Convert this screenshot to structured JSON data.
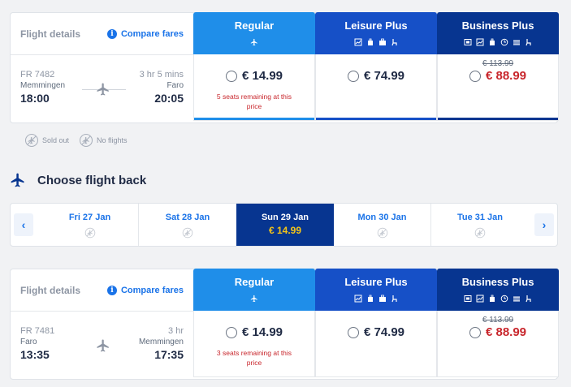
{
  "colors": {
    "regular": "#1f8ee9",
    "leisure": "#1650c7",
    "business": "#073590",
    "selected_date": "#073590",
    "promo_price": "#c8262c",
    "accent": "#1a73e8"
  },
  "outbound": {
    "details_title": "Flight details",
    "compare_label": "Compare fares",
    "flight_number": "FR 7482",
    "duration": "3 hr 5 mins",
    "from_city": "Memmingen",
    "to_city": "Faro",
    "depart_time": "18:00",
    "arrive_time": "20:05",
    "fares": {
      "regular": {
        "name": "Regular",
        "price": "€ 14.99",
        "seats_note": "5 seats remaining at this price"
      },
      "leisure": {
        "name": "Leisure Plus",
        "price": "€ 74.99"
      },
      "business": {
        "name": "Business Plus",
        "old_price": "€ 113.99",
        "price": "€ 88.99"
      }
    }
  },
  "legend": {
    "sold_out": "Sold out",
    "no_flights": "No flights"
  },
  "return_section": {
    "title": "Choose flight back",
    "dates": [
      {
        "label": "Fri 27 Jan",
        "status": "no-flights"
      },
      {
        "label": "Sat 28 Jan",
        "status": "no-flights"
      },
      {
        "label": "Sun 29 Jan",
        "price": "€ 14.99",
        "selected": true
      },
      {
        "label": "Mon 30 Jan",
        "status": "no-flights"
      },
      {
        "label": "Tue 31 Jan",
        "status": "no-flights"
      }
    ],
    "prev_arrow": "‹",
    "next_arrow": "›"
  },
  "inbound": {
    "details_title": "Flight details",
    "compare_label": "Compare fares",
    "flight_number": "FR 7481",
    "duration": "3 hr",
    "from_city": "Faro",
    "to_city": "Memmingen",
    "depart_time": "13:35",
    "arrive_time": "17:35",
    "fares": {
      "regular": {
        "name": "Regular",
        "price": "€ 14.99",
        "seats_note": "3 seats remaining at this price"
      },
      "leisure": {
        "name": "Leisure Plus",
        "price": "€ 74.99"
      },
      "business": {
        "name": "Business Plus",
        "old_price": "€ 113.99",
        "price": "€ 88.99"
      }
    }
  }
}
